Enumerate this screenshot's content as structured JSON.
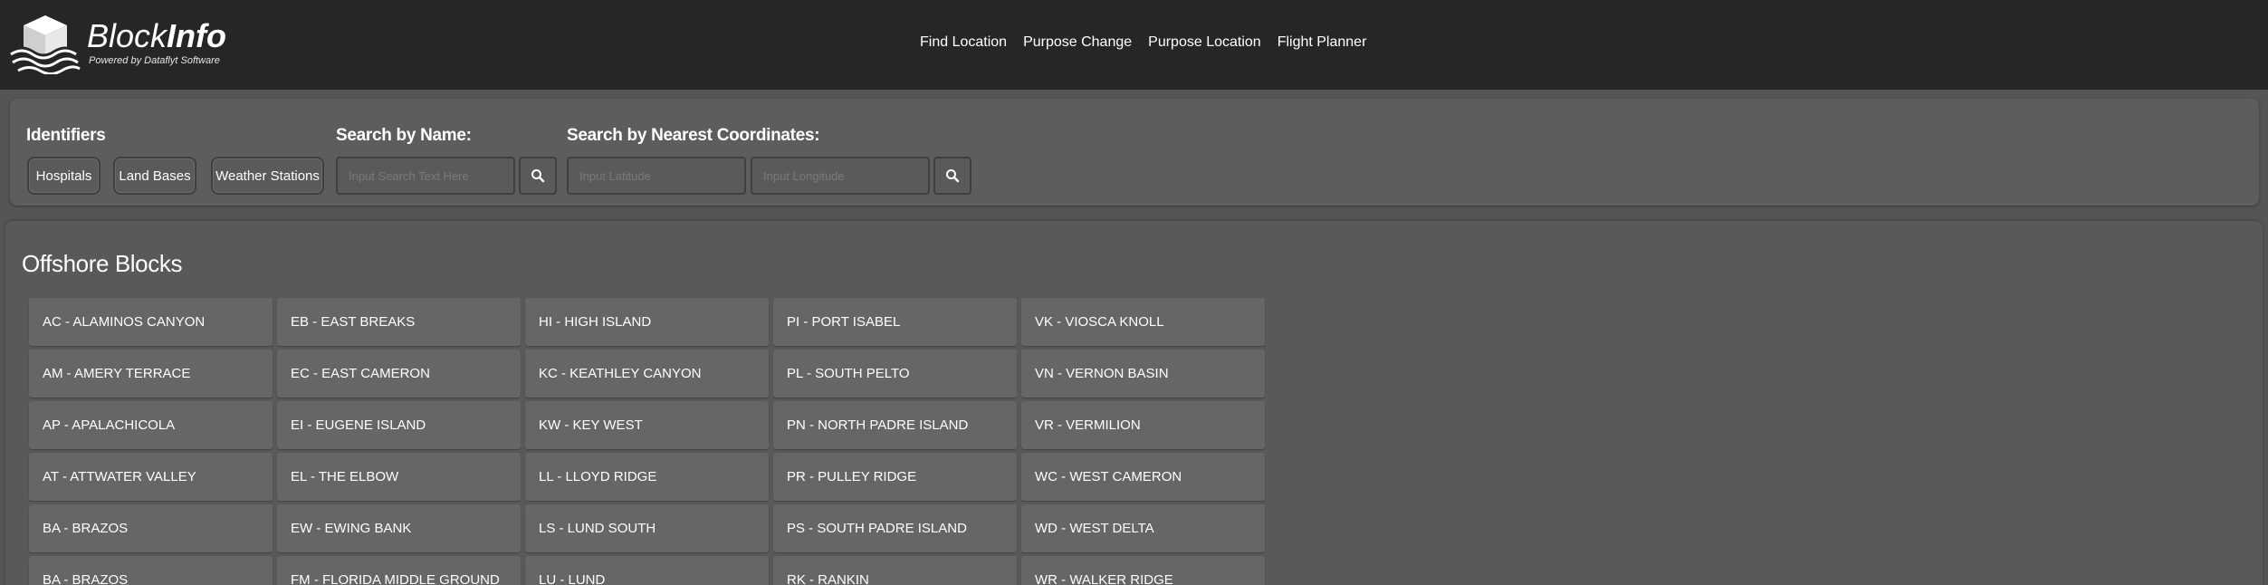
{
  "brand": {
    "title_light": "Block",
    "title_bold": "Info",
    "tagline": "Powered by Dataflyt Software"
  },
  "nav": {
    "items": [
      "Find Location",
      "Purpose Change",
      "Purpose Location",
      "Flight Planner"
    ]
  },
  "search": {
    "identifiers_label": "Identifiers",
    "identifiers": [
      "Hospitals",
      "Land Bases",
      "Weather Stations"
    ],
    "by_name_label": "Search by Name:",
    "name_placeholder": "Input Search Text Here",
    "by_coords_label": "Search by Nearest Coordinates:",
    "lat_placeholder": "Input Latitude",
    "lon_placeholder": "Input Longitude"
  },
  "blocks": {
    "title": "Offshore Blocks",
    "items": [
      "AC - ALAMINOS CANYON",
      "EB - EAST BREAKS",
      "HI - HIGH ISLAND",
      "PI - PORT ISABEL",
      "VK - VIOSCA KNOLL",
      "AM - AMERY TERRACE",
      "EC - EAST CAMERON",
      "KC - KEATHLEY CANYON",
      "PL - SOUTH PELTO",
      "VN - VERNON BASIN",
      "AP - APALACHICOLA",
      "EI - EUGENE ISLAND",
      "KW - KEY WEST",
      "PN - NORTH PADRE ISLAND",
      "VR - VERMILION",
      "AT - ATTWATER VALLEY",
      "EL - THE ELBOW",
      "LL - LLOYD RIDGE",
      "PR - PULLEY RIDGE",
      "WC - WEST CAMERON",
      "BA - BRAZOS",
      "EW - EWING BANK",
      "LS - LUND SOUTH",
      "PS - SOUTH PADRE ISLAND",
      "WD - WEST DELTA",
      "BA - BRAZOS",
      "FM - FLORIDA MIDDLE GROUND",
      "LU - LUND",
      "RK - RANKIN",
      "WR - WALKER RIDGE"
    ]
  }
}
